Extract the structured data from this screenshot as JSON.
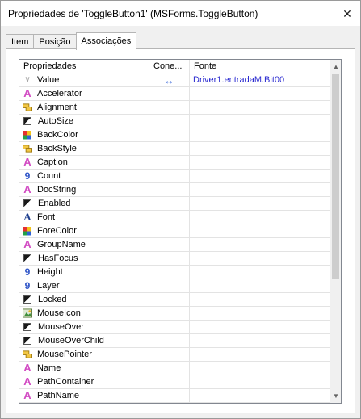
{
  "window": {
    "title": "Propriedades de 'ToggleButton1' (MSForms.ToggleButton)",
    "close_label": "✕"
  },
  "tabs": [
    {
      "label": "Item",
      "active": false
    },
    {
      "label": "Posição",
      "active": false
    },
    {
      "label": "Associações",
      "active": true
    }
  ],
  "grid": {
    "headers": {
      "property": "Propriedades",
      "connection": "Cone...",
      "source": "Fonte"
    },
    "rows": [
      {
        "name": "Value",
        "icon": "chevron-down-icon",
        "connection": "↔",
        "source": "Driver1.entradaM.Bit00"
      },
      {
        "name": "Accelerator",
        "icon": "string-icon",
        "connection": "",
        "source": ""
      },
      {
        "name": "Alignment",
        "icon": "enum-icon",
        "connection": "",
        "source": ""
      },
      {
        "name": "AutoSize",
        "icon": "boolean-icon",
        "connection": "",
        "source": ""
      },
      {
        "name": "BackColor",
        "icon": "color-icon",
        "connection": "",
        "source": ""
      },
      {
        "name": "BackStyle",
        "icon": "enum-icon",
        "connection": "",
        "source": ""
      },
      {
        "name": "Caption",
        "icon": "string-icon",
        "connection": "",
        "source": ""
      },
      {
        "name": "Count",
        "icon": "number-icon",
        "connection": "",
        "source": ""
      },
      {
        "name": "DocString",
        "icon": "string-icon",
        "connection": "",
        "source": ""
      },
      {
        "name": "Enabled",
        "icon": "boolean-icon",
        "connection": "",
        "source": ""
      },
      {
        "name": "Font",
        "icon": "font-icon",
        "connection": "",
        "source": ""
      },
      {
        "name": "ForeColor",
        "icon": "color-icon",
        "connection": "",
        "source": ""
      },
      {
        "name": "GroupName",
        "icon": "string-icon",
        "connection": "",
        "source": ""
      },
      {
        "name": "HasFocus",
        "icon": "boolean-icon",
        "connection": "",
        "source": ""
      },
      {
        "name": "Height",
        "icon": "number-icon",
        "connection": "",
        "source": ""
      },
      {
        "name": "Layer",
        "icon": "number-icon",
        "connection": "",
        "source": ""
      },
      {
        "name": "Locked",
        "icon": "boolean-icon",
        "connection": "",
        "source": ""
      },
      {
        "name": "MouseIcon",
        "icon": "picture-icon",
        "connection": "",
        "source": ""
      },
      {
        "name": "MouseOver",
        "icon": "boolean-icon",
        "connection": "",
        "source": ""
      },
      {
        "name": "MouseOverChild",
        "icon": "boolean-icon",
        "connection": "",
        "source": ""
      },
      {
        "name": "MousePointer",
        "icon": "enum-icon",
        "connection": "",
        "source": ""
      },
      {
        "name": "Name",
        "icon": "string-icon",
        "connection": "",
        "source": ""
      },
      {
        "name": "PathContainer",
        "icon": "string-icon",
        "connection": "",
        "source": ""
      },
      {
        "name": "PathName",
        "icon": "string-icon",
        "connection": "",
        "source": ""
      }
    ]
  },
  "scrollbar": {
    "up_icon": "▲",
    "down_icon": "▼"
  }
}
